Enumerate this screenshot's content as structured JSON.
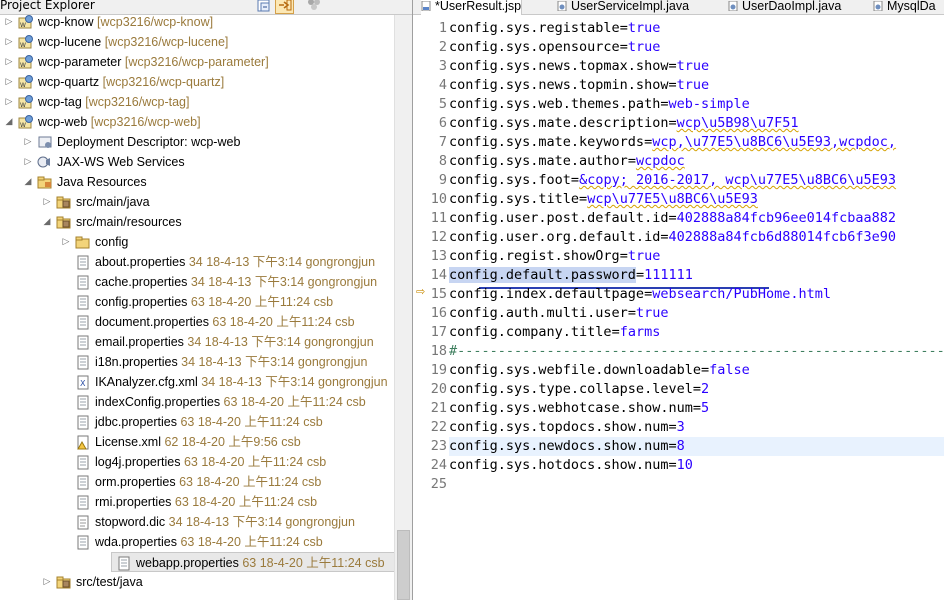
{
  "explorer": {
    "title": "Project Explorer",
    "tree": [
      {
        "id": "r0",
        "depth": 0,
        "expanded": false,
        "icon": "web-project-icon",
        "name": "wcp-know",
        "deco": "[wcp3216/wcp-know]"
      },
      {
        "id": "r1",
        "depth": 0,
        "expanded": false,
        "icon": "web-project-icon",
        "name": "wcp-lucene",
        "deco": "[wcp3216/wcp-lucene]"
      },
      {
        "id": "r2",
        "depth": 0,
        "expanded": false,
        "icon": "web-project-icon",
        "name": "wcp-parameter",
        "deco": "[wcp3216/wcp-parameter]"
      },
      {
        "id": "r3",
        "depth": 0,
        "expanded": false,
        "icon": "web-project-icon",
        "name": "wcp-quartz",
        "deco": "[wcp3216/wcp-quartz]"
      },
      {
        "id": "r4",
        "depth": 0,
        "expanded": false,
        "icon": "web-project-icon",
        "name": "wcp-tag",
        "deco": "[wcp3216/wcp-tag]"
      },
      {
        "id": "r5",
        "depth": 0,
        "expanded": true,
        "icon": "web-project-icon",
        "name": "wcp-web",
        "deco": "[wcp3216/wcp-web]"
      },
      {
        "id": "r6",
        "depth": 1,
        "expanded": false,
        "icon": "deployment-descriptor-icon",
        "name": "Deployment Descriptor: wcp-web",
        "deco": ""
      },
      {
        "id": "r7",
        "depth": 1,
        "expanded": false,
        "icon": "web-services-icon",
        "name": "JAX-WS Web Services",
        "deco": ""
      },
      {
        "id": "r8",
        "depth": 1,
        "expanded": true,
        "icon": "java-resources-icon",
        "name": "Java Resources",
        "deco": ""
      },
      {
        "id": "r9",
        "depth": 2,
        "expanded": false,
        "icon": "source-folder-icon",
        "name": "src/main/java",
        "deco": ""
      },
      {
        "id": "r10",
        "depth": 2,
        "expanded": true,
        "icon": "source-folder-icon",
        "name": "src/main/resources",
        "deco": ""
      },
      {
        "id": "r11",
        "depth": 3,
        "expanded": false,
        "icon": "folder-icon",
        "name": "config",
        "deco": ""
      },
      {
        "id": "r12",
        "depth": 3,
        "leaf": true,
        "icon": "properties-file-icon",
        "name": "about.properties",
        "deco": "34  18-4-13 下午3:14  gongrongjun"
      },
      {
        "id": "r13",
        "depth": 3,
        "leaf": true,
        "icon": "properties-file-icon",
        "name": "cache.properties",
        "deco": "34  18-4-13 下午3:14  gongrongjun"
      },
      {
        "id": "r14",
        "depth": 3,
        "leaf": true,
        "icon": "properties-file-icon",
        "name": "config.properties",
        "deco": "63  18-4-20 上午11:24  csb"
      },
      {
        "id": "r15",
        "depth": 3,
        "leaf": true,
        "icon": "properties-file-icon",
        "name": "document.properties",
        "deco": "63  18-4-20 上午11:24  csb"
      },
      {
        "id": "r16",
        "depth": 3,
        "leaf": true,
        "icon": "properties-file-icon",
        "name": "email.properties",
        "deco": "34  18-4-13 下午3:14  gongrongjun"
      },
      {
        "id": "r17",
        "depth": 3,
        "leaf": true,
        "icon": "properties-file-icon",
        "name": "i18n.properties",
        "deco": "34  18-4-13 下午3:14  gongrongjun"
      },
      {
        "id": "r18",
        "depth": 3,
        "leaf": true,
        "icon": "xml-file-icon",
        "name": "IKAnalyzer.cfg.xml",
        "deco": "34  18-4-13 下午3:14  gongrongjun"
      },
      {
        "id": "r19",
        "depth": 3,
        "leaf": true,
        "icon": "properties-file-icon",
        "name": "indexConfig.properties",
        "deco": "63  18-4-20 上午11:24  csb"
      },
      {
        "id": "r20",
        "depth": 3,
        "leaf": true,
        "icon": "properties-file-icon",
        "name": "jdbc.properties",
        "deco": "63  18-4-20 上午11:24  csb"
      },
      {
        "id": "r21",
        "depth": 3,
        "leaf": true,
        "icon": "xml-warning-file-icon",
        "name": "License.xml",
        "deco": "62  18-4-20 上午9:56  csb"
      },
      {
        "id": "r22",
        "depth": 3,
        "leaf": true,
        "icon": "properties-file-icon",
        "name": "log4j.properties",
        "deco": "63  18-4-20 上午11:24  csb"
      },
      {
        "id": "r23",
        "depth": 3,
        "leaf": true,
        "icon": "properties-file-icon",
        "name": "orm.properties",
        "deco": "63  18-4-20 上午11:24  csb"
      },
      {
        "id": "r24",
        "depth": 3,
        "leaf": true,
        "icon": "properties-file-icon",
        "name": "rmi.properties",
        "deco": "63  18-4-20 上午11:24  csb"
      },
      {
        "id": "r25",
        "depth": 3,
        "leaf": true,
        "icon": "text-file-icon",
        "name": "stopword.dic",
        "deco": "34  18-4-13 下午3:14  gongrongjun"
      },
      {
        "id": "r26",
        "depth": 3,
        "leaf": true,
        "icon": "properties-file-icon",
        "name": "wda.properties",
        "deco": "63  18-4-20 上午11:24  csb"
      },
      {
        "id": "r27",
        "depth": 3,
        "leaf": true,
        "selected": true,
        "icon": "properties-file-icon",
        "name": "webapp.properties",
        "deco": "63  18-4-20 上午11:24  csb"
      },
      {
        "id": "r28",
        "depth": 2,
        "expanded": false,
        "icon": "source-folder-icon",
        "name": "src/test/java",
        "deco": ""
      }
    ]
  },
  "editor": {
    "tabs": [
      {
        "label": "*UserResult.jsp",
        "icon": "jsp-file-icon",
        "active": true
      },
      {
        "label": "UserServiceImpl.java",
        "icon": "java-file-icon",
        "active": false
      },
      {
        "label": "UserDaoImpl.java",
        "icon": "java-file-icon",
        "active": false
      },
      {
        "label": "MysqlDa",
        "icon": "java-file-icon",
        "active": false
      }
    ],
    "current_line": 23,
    "marker_line": 14,
    "lines": [
      {
        "n": "1",
        "k": "config.sys.registable",
        "v": "true"
      },
      {
        "n": "2",
        "k": "config.sys.opensource",
        "v": "true"
      },
      {
        "n": "3",
        "k": "config.sys.news.topmax.show",
        "v": "true"
      },
      {
        "n": "4",
        "k": "config.sys.news.topmin.show",
        "v": "true"
      },
      {
        "n": "5",
        "k": "config.sys.web.themes.path",
        "v": "web-simple"
      },
      {
        "n": "6",
        "k": "config.sys.mate.description",
        "v": "wcp\\u5B98\\u7F51"
      },
      {
        "n": "7",
        "k": "config.sys.mate.keywords",
        "v": "wcp,\\u77E5\\u8BC6\\u5E93,wcpdoc,"
      },
      {
        "n": "8",
        "k": "config.sys.mate.author",
        "v": "wcpdoc"
      },
      {
        "n": "9",
        "k": "config.sys.foot",
        "v": "&copy; 2016-2017, wcp\\u77E5\\u8BC6\\u5E93"
      },
      {
        "n": "10",
        "k": "config.sys.title",
        "v": "wcp\\u77E5\\u8BC6\\u5E93"
      },
      {
        "n": "11",
        "k": "config.user.post.default.id",
        "v": "402888a84fcb96ee014fcbaa882"
      },
      {
        "n": "12",
        "k": "config.user.org.default.id",
        "v": "402888a84fcb6d88014fcb6f3e90"
      },
      {
        "n": "13",
        "k": "config.regist.showOrg",
        "v": "true"
      },
      {
        "n": "14",
        "k": "config.default.password",
        "v": "111111"
      },
      {
        "n": "15",
        "k": "config.index.defaultpage",
        "v": "websearch/PubHome.html"
      },
      {
        "n": "16",
        "k": "config.auth.multi.user",
        "v": "true"
      },
      {
        "n": "17",
        "k": "config.company.title",
        "v": "farms"
      },
      {
        "n": "18",
        "comment": "#-----------------------------------------------------------------------"
      },
      {
        "n": "19",
        "k": "config.sys.webfile.downloadable",
        "v": "false"
      },
      {
        "n": "20",
        "k": "config.sys.type.collapse.level",
        "v": "2"
      },
      {
        "n": "21",
        "k": "config.sys.webhotcase.show.num",
        "v": "5"
      },
      {
        "n": "22",
        "k": "config.sys.topdocs.show.num",
        "v": "3"
      },
      {
        "n": "23",
        "k": "config.sys.newdocs.show.num",
        "v": "8"
      },
      {
        "n": "24",
        "k": "config.sys.hotdocs.show.num",
        "v": "10"
      },
      {
        "n": "25",
        "k": "",
        "v": ""
      }
    ]
  },
  "colors": {
    "key": "#000000",
    "value": "#2a00ff",
    "comment": "#3f7f5f",
    "current_line": "#e8f2fe",
    "highlight": "#c7d5f2"
  }
}
